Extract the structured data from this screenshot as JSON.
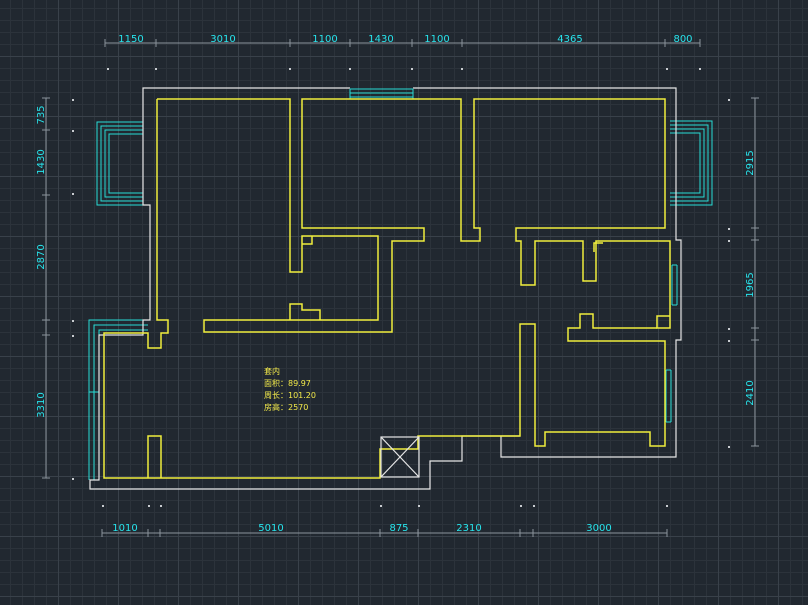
{
  "colors": {
    "background": "#212830",
    "grid": "#39414a",
    "outer_wall": "#e6e6e6",
    "room_outline": "#f0ee3c",
    "window": "#27dcd6",
    "dimension": "#27e4ec",
    "dimension_line": "#8c949c"
  },
  "dimensions": {
    "top": [
      "1150",
      "3010",
      "1100",
      "1430",
      "1100",
      "4365",
      "800"
    ],
    "bottom": [
      "1010",
      "5010",
      "875",
      "2310",
      "3000"
    ],
    "left": [
      "735",
      "1430",
      "2870",
      "3310"
    ],
    "right": [
      "2915",
      "1965",
      "2410"
    ]
  },
  "room_info": {
    "name": "套内",
    "area": "面积：89.97",
    "perimeter": "周长：101.20",
    "height": "房高：2570"
  }
}
